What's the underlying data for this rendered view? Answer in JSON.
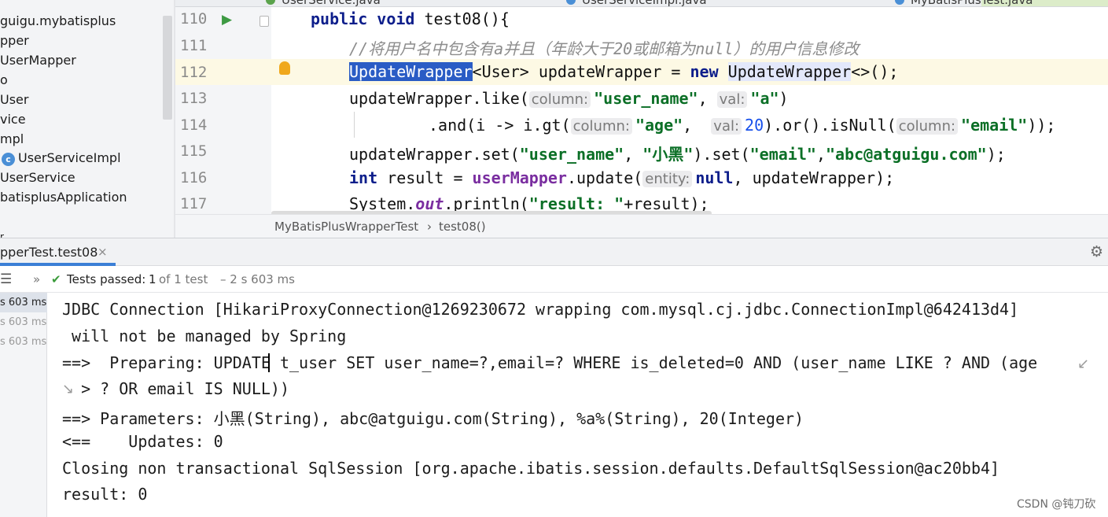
{
  "tree": {
    "items": [
      "guigu.mybatisplus",
      "pper",
      "UserMapper",
      "o",
      "User",
      "vice",
      "mpl",
      "UserServiceImpl",
      "UserService",
      "batisplusApplication",
      "r"
    ],
    "class_icon_letter": "c"
  },
  "editor": {
    "tabs": [
      "UserService.java",
      "UserServiceImpl.java",
      "MyBatisPlusTest.java"
    ],
    "line_numbers": [
      "110",
      "111",
      "112",
      "113",
      "114",
      "115",
      "116",
      "117"
    ],
    "code": {
      "l110_kw": "public void",
      "l110_rest": " test08(){",
      "l111_comment": "//将用户名中包含有a并且（年龄大于20或邮箱为null）的用户信息修改",
      "l112_sel": "UpdateWrapper",
      "l112_mid": "<User> updateWrapper = ",
      "l112_kw": "new",
      "l112_cls": "UpdateWrapper",
      "l112_end": "<>();",
      "l113_a": "updateWrapper.like(",
      "l113_hint1": "column:",
      "l113_s1": "\"user_name\"",
      "l113_b": ", ",
      "l113_hint2": "val:",
      "l113_s2": "\"a\"",
      "l113_end": ")",
      "l114_a": ".and(i -> i.gt(",
      "l114_hint1": "column:",
      "l114_s1": "\"age\"",
      "l114_b": ",  ",
      "l114_hint2": "val:",
      "l114_n": "20",
      "l114_c": ").or().isNull(",
      "l114_hint3": "column:",
      "l114_s3": "\"email\"",
      "l114_end": "));",
      "l115_a": "updateWrapper.set(",
      "l115_s1": "\"user_name\"",
      "l115_b": ", ",
      "l115_s2": "\"小黑\"",
      "l115_c": ").set(",
      "l115_s3": "\"email\"",
      "l115_d": ",",
      "l115_s4": "\"abc@atguigu.com\"",
      "l115_end": ");",
      "l116_kw": "int",
      "l116_a": " result = ",
      "l116_ref": "userMapper",
      "l116_b": ".update(",
      "l116_hint": "entity:",
      "l116_kw2": "null",
      "l116_end": ", updateWrapper);",
      "l117_a": "System.",
      "l117_fld": "out",
      "l117_b": ".println(",
      "l117_s": "\"result: \"",
      "l117_end": "+result);"
    },
    "breadcrumb": [
      "MyBatisPlusWrapperTest",
      "›",
      "test08()"
    ]
  },
  "run": {
    "tab_label": "pperTest.test08",
    "tab_close": "×",
    "status": {
      "prefix": "Tests passed:",
      "count": "1",
      "of": "of 1 test",
      "duration": "– 2 s 603 ms"
    },
    "times": [
      "s 603 ms",
      "s 603 ms",
      "s 603 ms"
    ],
    "console": [
      "JDBC Connection [HikariProxyConnection@1269230672 wrapping com.mysql.cj.jdbc.ConnectionImpl@642413d4]",
      " will not be managed by Spring",
      "==>  Preparing: UPDATE t_user SET user_name=?,email=? WHERE is_deleted=0 AND (user_name LIKE ? AND (age",
      "  > ? OR email IS NULL))",
      "==> Parameters: 小黑(String), abc@atguigu.com(String), %a%(String), 20(Integer)",
      "<==    Updates: 0",
      "Closing non transactional SqlSession [org.apache.ibatis.session.defaults.DefaultSqlSession@ac20bb4]",
      "result: 0"
    ]
  },
  "watermark": "CSDN @钝刀砍",
  "colors": {
    "keyword": "#0d1e8b",
    "string": "#0b6f26",
    "comment": "#8c8c8c",
    "selection": "#2a5cc5",
    "accent": "#3b7fd6",
    "pass": "#3a9b3a"
  }
}
